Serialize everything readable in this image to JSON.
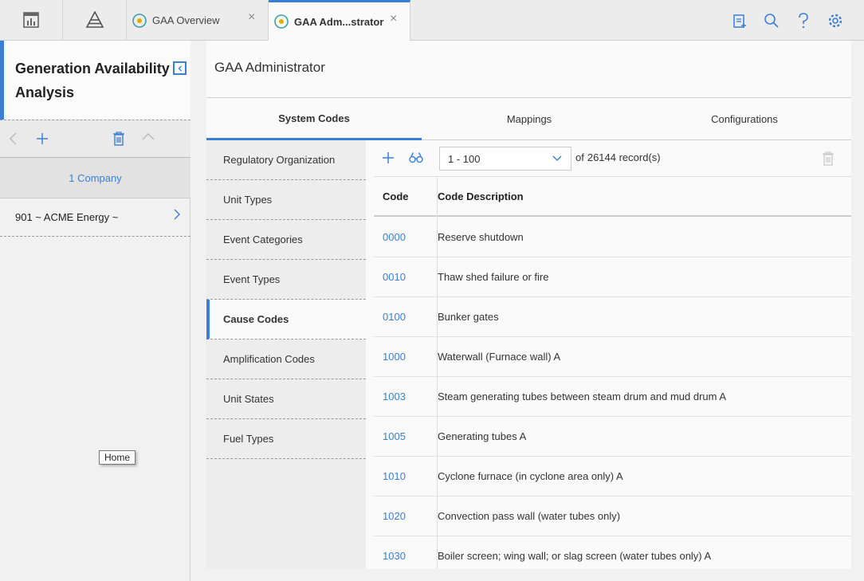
{
  "topbar": {
    "tabs": [
      {
        "label": "GAA Overview",
        "close": "×"
      },
      {
        "label": "GAA Adm...strator",
        "close": "×"
      }
    ]
  },
  "left": {
    "title": "Generation Availability Analysis",
    "company_header": "1 Company",
    "company_row": "901 ~ ACME Energy ~",
    "tooltip": "Home"
  },
  "main": {
    "title": "GAA Administrator",
    "tabs": [
      "System Codes",
      "Mappings",
      "Configurations"
    ],
    "active_tab": "System Codes",
    "nav": [
      "Regulatory Organization",
      "Unit Types",
      "Event Categories",
      "Event Types",
      "Cause Codes",
      "Amplification Codes",
      "Unit States",
      "Fuel Types"
    ],
    "active_nav": "Cause Codes",
    "range": "1 - 100",
    "records_prefix": "of",
    "records_count": "26144 record(s)",
    "columns": {
      "code": "Code",
      "desc": "Code Description"
    },
    "rows": [
      {
        "code": "0000",
        "desc": "Reserve shutdown"
      },
      {
        "code": "0010",
        "desc": "Thaw shed failure or fire"
      },
      {
        "code": "0100",
        "desc": "Bunker gates"
      },
      {
        "code": "1000",
        "desc": "Waterwall (Furnace wall) A"
      },
      {
        "code": "1003",
        "desc": "Steam generating tubes between steam drum and mud drum A"
      },
      {
        "code": "1005",
        "desc": "Generating tubes A"
      },
      {
        "code": "1010",
        "desc": "Cyclone furnace (in cyclone area only) A"
      },
      {
        "code": "1020",
        "desc": "Convection pass wall (water tubes only)"
      },
      {
        "code": "1030",
        "desc": "Boiler screen; wing wall; or slag screen (water tubes only) A"
      }
    ]
  },
  "colors": {
    "accent": "#3a7fd6",
    "icon": "#3a7fd6",
    "muted": "#bbbbbb"
  }
}
